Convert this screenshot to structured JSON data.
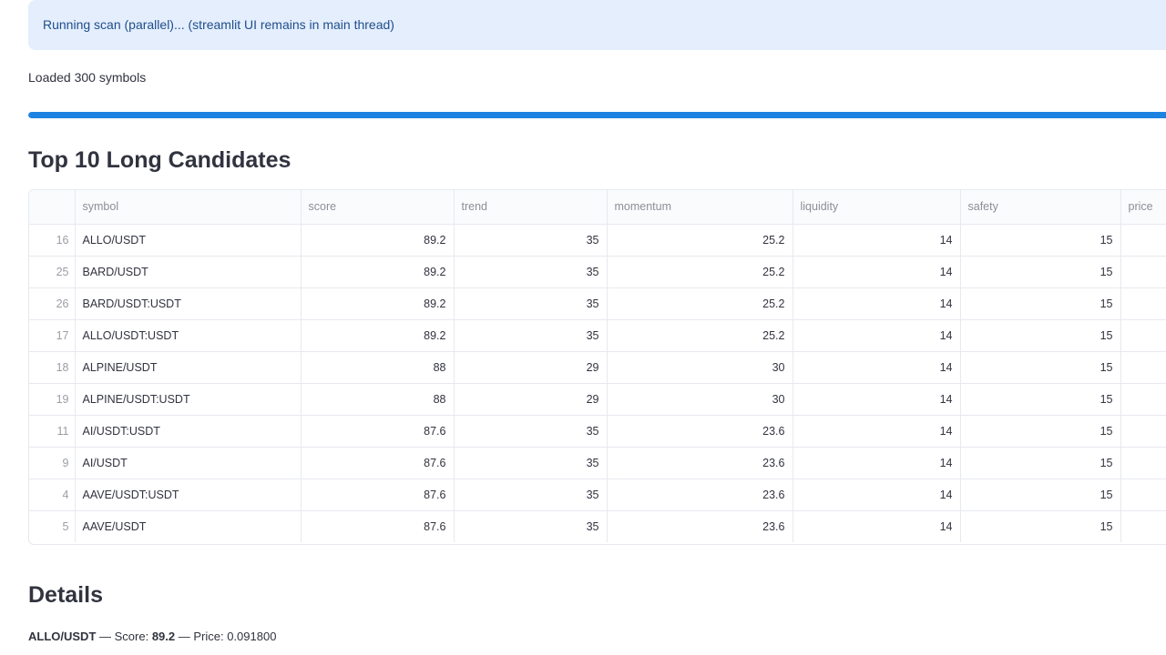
{
  "alert": {
    "text": "Running scan (parallel)... (streamlit UI remains in main thread)"
  },
  "status": {
    "loaded": "Loaded 300 symbols"
  },
  "progress": {
    "fraction": 1.0,
    "color": "#1c83e1"
  },
  "headings": {
    "top": "Top 10 Long Candidates",
    "details": "Details"
  },
  "table": {
    "columns": [
      "",
      "symbol",
      "score",
      "trend",
      "momentum",
      "liquidity",
      "safety",
      "price"
    ],
    "rows": [
      {
        "index": "16",
        "symbol": "ALLO/USDT",
        "score": "89.2",
        "trend": "35",
        "momentum": "25.2",
        "liquidity": "14",
        "safety": "15"
      },
      {
        "index": "25",
        "symbol": "BARD/USDT",
        "score": "89.2",
        "trend": "35",
        "momentum": "25.2",
        "liquidity": "14",
        "safety": "15"
      },
      {
        "index": "26",
        "symbol": "BARD/USDT:USDT",
        "score": "89.2",
        "trend": "35",
        "momentum": "25.2",
        "liquidity": "14",
        "safety": "15"
      },
      {
        "index": "17",
        "symbol": "ALLO/USDT:USDT",
        "score": "89.2",
        "trend": "35",
        "momentum": "25.2",
        "liquidity": "14",
        "safety": "15"
      },
      {
        "index": "18",
        "symbol": "ALPINE/USDT",
        "score": "88",
        "trend": "29",
        "momentum": "30",
        "liquidity": "14",
        "safety": "15"
      },
      {
        "index": "19",
        "symbol": "ALPINE/USDT:USDT",
        "score": "88",
        "trend": "29",
        "momentum": "30",
        "liquidity": "14",
        "safety": "15"
      },
      {
        "index": "11",
        "symbol": "AI/USDT:USDT",
        "score": "87.6",
        "trend": "35",
        "momentum": "23.6",
        "liquidity": "14",
        "safety": "15"
      },
      {
        "index": "9",
        "symbol": "AI/USDT",
        "score": "87.6",
        "trend": "35",
        "momentum": "23.6",
        "liquidity": "14",
        "safety": "15"
      },
      {
        "index": "4",
        "symbol": "AAVE/USDT:USDT",
        "score": "87.6",
        "trend": "35",
        "momentum": "23.6",
        "liquidity": "14",
        "safety": "15"
      },
      {
        "index": "5",
        "symbol": "AAVE/USDT",
        "score": "87.6",
        "trend": "35",
        "momentum": "23.6",
        "liquidity": "14",
        "safety": "15"
      }
    ]
  },
  "details": {
    "symbol": "ALLO/USDT",
    "sep1": " — Score: ",
    "score": "89.2",
    "sep2": " — Price: ",
    "price": "0.091800"
  }
}
